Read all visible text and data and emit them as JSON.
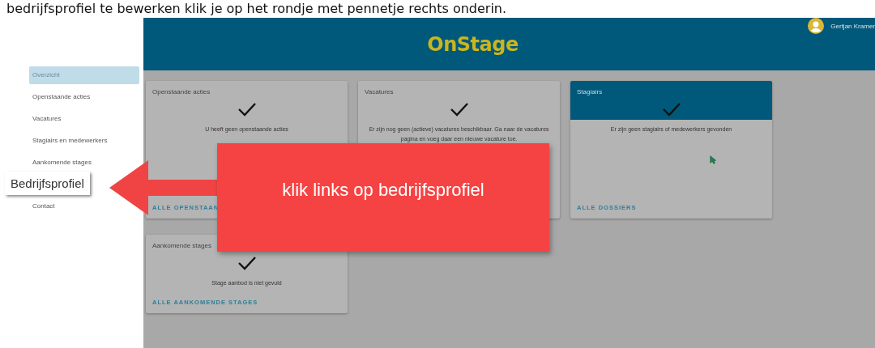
{
  "caption": "bedrijfsprofiel te bewerken klik je op het rondje met pennetje rechts onderin.",
  "header": {
    "logo": "OnStage",
    "user": "Gertjan Kramer"
  },
  "sidebar": {
    "items": [
      {
        "label": "Overzicht",
        "selected": true
      },
      {
        "label": "Openstaande acties",
        "selected": false
      },
      {
        "label": "Vacatures",
        "selected": false
      },
      {
        "label": "Stagiairs en medewerkers",
        "selected": false
      },
      {
        "label": "Aankomende stages",
        "selected": false
      },
      {
        "label": "Contact",
        "selected": false
      }
    ]
  },
  "cards": [
    {
      "kind": "plain",
      "title": "Openstaande acties",
      "message": "U heeft geen openstaande acties",
      "link": "ALLE OPENSTAAN"
    },
    {
      "kind": "plain",
      "title": "Vacatures",
      "message": "Er zijn nog geen (actieve) vacatures beschikbaar. Ga naar de vacatures pagina en voeg daar een nieuwe vacature toe."
    },
    {
      "kind": "highlight",
      "title": "Stagiairs",
      "message": "Er zijn geen stagiairs of medewerkers gevonden",
      "link": "ALLE DOSSIERS"
    },
    {
      "kind": "plain",
      "title": "Aankomende stages",
      "message": "Stage aanbod is niet gevuld",
      "link": "ALLE AANKOMENDE STAGES"
    }
  ],
  "callout": {
    "text": "klik links op bedrijfsprofiel",
    "tag": "Bedrijfsprofiel"
  }
}
